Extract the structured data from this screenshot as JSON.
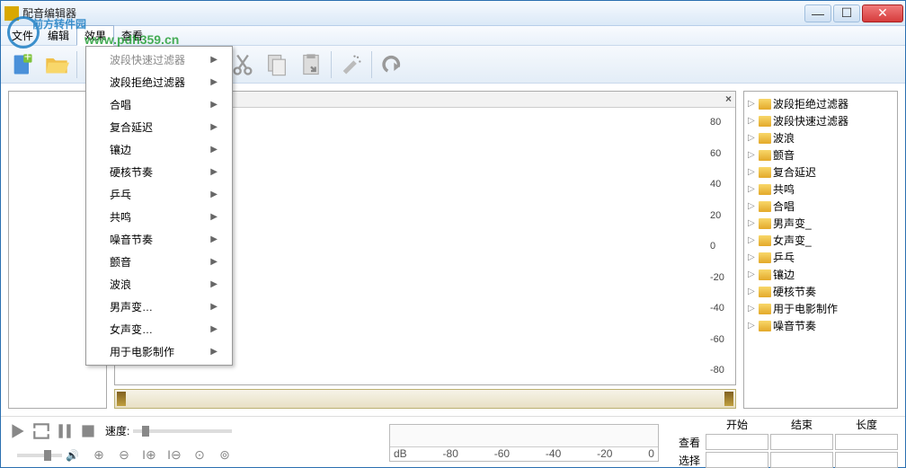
{
  "window": {
    "title": "配音编辑器"
  },
  "menubar": {
    "items": [
      "文件",
      "编辑",
      "效果",
      "查看"
    ],
    "active_index": 2
  },
  "dropdown": {
    "items": [
      "波段快速过滤器",
      "波段拒绝过滤器",
      "合唱",
      "复合延迟",
      "镶边",
      "硬核节奏",
      "乒乓",
      "共鸣",
      "噪音节奏",
      "颤音",
      "波浪",
      "男声变…",
      "女声变…",
      "用于电影制作"
    ]
  },
  "tree": {
    "items": [
      "波段拒绝过滤器",
      "波段快速过滤器",
      "波浪",
      "颤音",
      "复合延迟",
      "共鸣",
      "合唱",
      "男声变_",
      "女声变_",
      "乒乓",
      "镶边",
      "硬核节奏",
      "用于电影制作",
      "噪音节奏"
    ]
  },
  "yaxis": [
    "80",
    "60",
    "40",
    "20",
    "0",
    "-20",
    "-40",
    "-60",
    "-80"
  ],
  "speed_label": "速度:",
  "meter_scale": [
    "dB",
    "-80",
    "-60",
    "-40",
    "-20",
    "0"
  ],
  "selection": {
    "headers": [
      "开始",
      "结束",
      "长度"
    ],
    "rows": [
      "查看",
      "选择"
    ]
  }
}
